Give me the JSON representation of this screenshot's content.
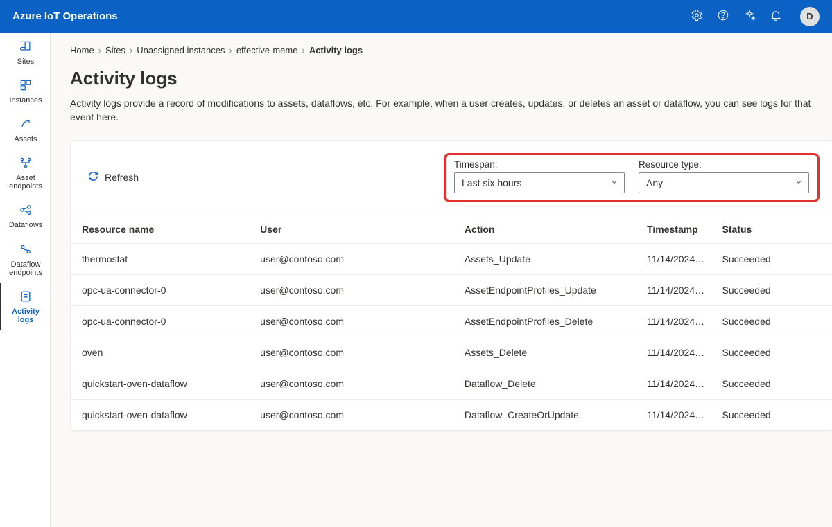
{
  "header": {
    "title": "Azure IoT Operations",
    "avatar_initial": "D"
  },
  "sidebar": {
    "items": [
      {
        "label": "Sites",
        "icon": "book"
      },
      {
        "label": "Instances",
        "icon": "instances"
      },
      {
        "label": "Assets",
        "icon": "arrow"
      },
      {
        "label": "Asset\nendpoints",
        "icon": "dots"
      },
      {
        "label": "Dataflows",
        "icon": "flow"
      },
      {
        "label": "Dataflow\nendpoints",
        "icon": "flow-ep"
      },
      {
        "label": "Activity\nlogs",
        "icon": "activity"
      }
    ],
    "active_index": 6
  },
  "breadcrumbs": [
    "Home",
    "Sites",
    "Unassigned instances",
    "effective-meme",
    "Activity logs"
  ],
  "page": {
    "title": "Activity logs",
    "description": "Activity logs provide a record of modifications to assets, dataflows, etc. For example, when a user creates, updates, or deletes an asset or dataflow, you can see logs for that event here."
  },
  "toolbar": {
    "refresh_label": "Refresh"
  },
  "filters": {
    "timespan": {
      "label": "Timespan:",
      "value": "Last six hours"
    },
    "resource_type": {
      "label": "Resource type:",
      "value": "Any"
    }
  },
  "table": {
    "columns": [
      "Resource name",
      "User",
      "Action",
      "Timestamp",
      "Status"
    ],
    "rows": [
      {
        "resource": "thermostat",
        "user": "user@contoso.com",
        "action": "Assets_Update",
        "timestamp": "11/14/2024…",
        "status": "Succeeded"
      },
      {
        "resource": "opc-ua-connector-0",
        "user": "user@contoso.com",
        "action": "AssetEndpointProfiles_Update",
        "timestamp": "11/14/2024…",
        "status": "Succeeded"
      },
      {
        "resource": "opc-ua-connector-0",
        "user": "user@contoso.com",
        "action": "AssetEndpointProfiles_Delete",
        "timestamp": "11/14/2024…",
        "status": "Succeeded"
      },
      {
        "resource": "oven",
        "user": "user@contoso.com",
        "action": "Assets_Delete",
        "timestamp": "11/14/2024…",
        "status": "Succeeded"
      },
      {
        "resource": "quickstart-oven-dataflow",
        "user": "user@contoso.com",
        "action": "Dataflow_Delete",
        "timestamp": "11/14/2024…",
        "status": "Succeeded"
      },
      {
        "resource": "quickstart-oven-dataflow",
        "user": "user@contoso.com",
        "action": "Dataflow_CreateOrUpdate",
        "timestamp": "11/14/2024…",
        "status": "Succeeded"
      }
    ]
  }
}
